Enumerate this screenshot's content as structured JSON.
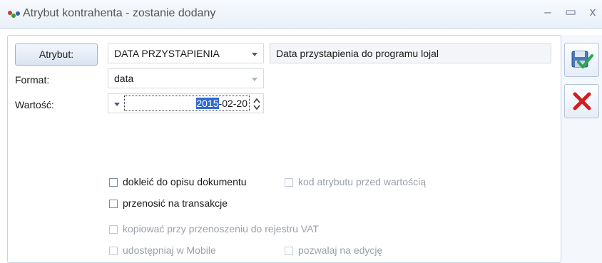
{
  "window": {
    "title": "Atrybut kontrahenta - zostanie dodany",
    "minimize": "–",
    "maximize": "▭",
    "close": "x"
  },
  "form": {
    "attribute_button": "Atrybut:",
    "attribute_value": "DATA PRZYSTAPIENIA",
    "attribute_description": "Data przystapienia do programu lojal",
    "format_label": "Format:",
    "format_value": "data",
    "value_label": "Wartość:",
    "value_date_selected": "2015",
    "value_date_rest": "-02-20"
  },
  "options": {
    "append_to_description": "dokleić do opisu dokumentu",
    "code_before_value": "kod atrybutu przed wartością",
    "transfer_to_transactions": "przenosić na transakcje",
    "copy_to_vat_register": "kopiować przy przenoszeniu do rejestru VAT",
    "share_in_mobile": "udostępniaj w Mobile",
    "allow_edit": "pozwalaj na edycję"
  },
  "icons": {
    "save": "save-check-icon",
    "cancel": "red-x-icon"
  }
}
